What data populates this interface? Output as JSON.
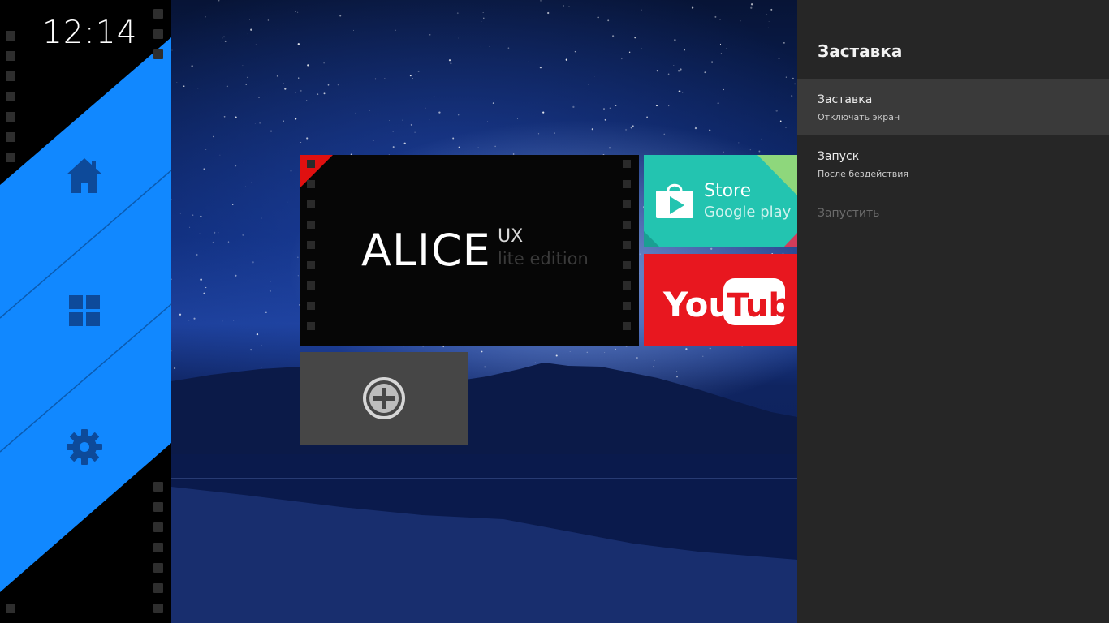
{
  "clock": {
    "time": "12:14"
  },
  "sidebar": {
    "accent_color": "#1188ff",
    "items": [
      {
        "name": "home",
        "icon": "home-icon"
      },
      {
        "name": "apps",
        "icon": "windows-grid-icon"
      },
      {
        "name": "settings",
        "icon": "gear-icon"
      }
    ]
  },
  "tiles": {
    "alice": {
      "title": "ALICE",
      "superscript": "UX",
      "edition": "lite edition"
    },
    "store": {
      "title": "Store",
      "subtitle": "Google play",
      "icon": "play-store-bag-icon",
      "color": "#23c4b0"
    },
    "youtube": {
      "label_you": "You",
      "label_tube": "Tube",
      "color": "#e8171f"
    },
    "add": {
      "icon": "add-circle-icon"
    }
  },
  "panel": {
    "title": "Заставка",
    "items": [
      {
        "label": "Заставка",
        "subtitle": "Отключать экран",
        "selected": true
      },
      {
        "label": "Запуск",
        "subtitle": "После  бездействия",
        "selected": false
      },
      {
        "label": "Запустить",
        "disabled": true
      }
    ]
  }
}
